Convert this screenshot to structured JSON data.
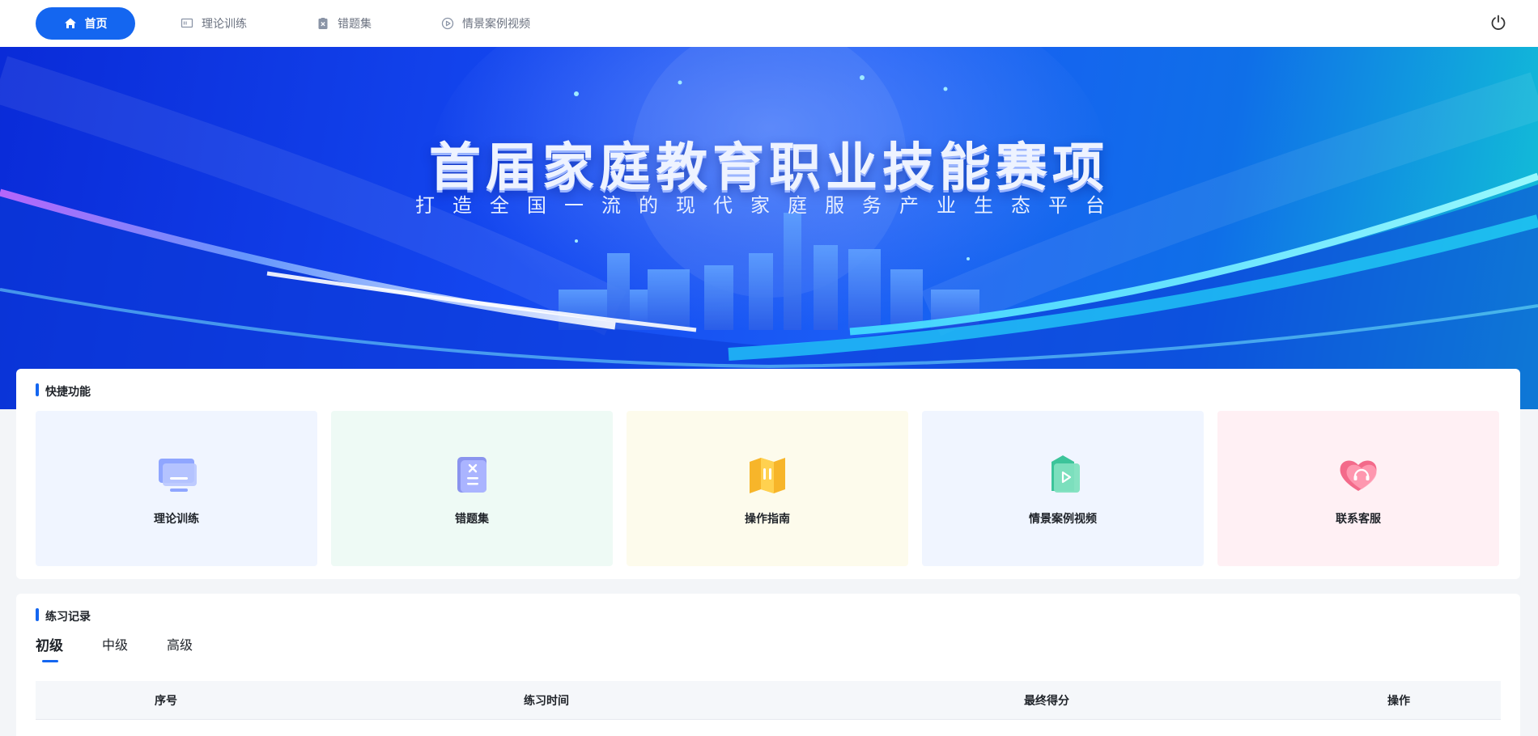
{
  "nav": {
    "items": [
      {
        "label": "首页",
        "icon": "home-icon",
        "active": true
      },
      {
        "label": "理论训练",
        "icon": "monitor-icon",
        "active": false
      },
      {
        "label": "错题集",
        "icon": "clipboard-icon",
        "active": false
      },
      {
        "label": "情景案例视频",
        "icon": "play-circle-icon",
        "active": false
      }
    ],
    "power_icon": "power-icon",
    "accent": "#1466f0"
  },
  "banner": {
    "title": "首届家庭教育职业技能赛项",
    "subtitle": "打造全国一流的现代家庭服务产业生态平台"
  },
  "quick": {
    "title": "快捷功能",
    "tiles": [
      {
        "label": "理论训练",
        "icon": "monitor-icon",
        "bg": "#f0f5ff"
      },
      {
        "label": "错题集",
        "icon": "error-book-icon",
        "bg": "#eefaf5"
      },
      {
        "label": "操作指南",
        "icon": "map-guide-icon",
        "bg": "#fdfbec"
      },
      {
        "label": "情景案例视频",
        "icon": "video-play-icon",
        "bg": "#f0f5ff"
      },
      {
        "label": "联系客服",
        "icon": "support-heart-icon",
        "bg": "#fff0f4"
      }
    ]
  },
  "records": {
    "title": "练习记录",
    "tabs": [
      {
        "label": "初级",
        "active": true
      },
      {
        "label": "中级",
        "active": false
      },
      {
        "label": "高级",
        "active": false
      }
    ],
    "columns": [
      "序号",
      "练习时间",
      "最终得分",
      "操作"
    ]
  }
}
